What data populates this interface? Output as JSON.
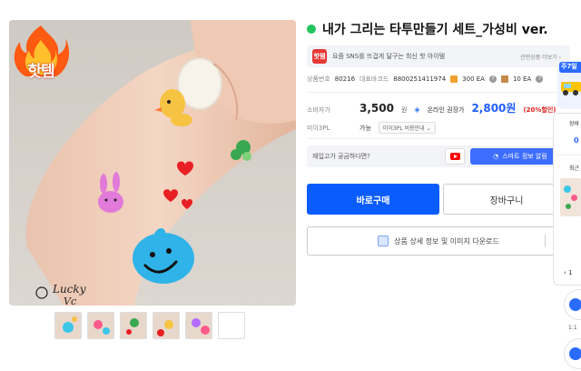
{
  "product": {
    "hot_badge": "핫템",
    "title": "내가 그리는 타투만들기 세트_가성비 ver.",
    "banner_icon": "핫템",
    "banner_text": "요즘 SNS를 뜨겁게 달구는 최신 핫 아이템",
    "banner_link": "관련상품 더보기 ›",
    "code_label": "상품번호",
    "code_value": "80216",
    "barcode_label": "대표바코드",
    "barcode_value": "8800251411974",
    "box_qty": "300 EA",
    "inner_qty": "10 EA",
    "consumer_label": "소비자가",
    "consumer_price": "3,500",
    "won": "원",
    "online_label": "온라인 권장가",
    "online_price": "2,800원",
    "discount": "(20%할인)",
    "pl_label": "미이3PL",
    "pl_sub": "가능",
    "pl_select": "미이3PL 비용안내 ⌄",
    "stock_question": "재입고가 궁금하다면?",
    "smart_alert": "스마트 정보 알림",
    "buy_now": "바로구매",
    "cart": "장바구니",
    "detail_download": "상품 상세 정보 및 이미지 다운로드"
  },
  "thumbnails": [
    {
      "accent": "#3cc6e8"
    },
    {
      "accent": "#ff5a8a"
    },
    {
      "accent": "#3aa850"
    },
    {
      "accent": "#f6c343"
    },
    {
      "accent": "#b36bff"
    },
    {
      "accent": ""
    }
  ],
  "side_widget": {
    "tag": "주7일",
    "panel_title_1": "장바",
    "panel_count": "0",
    "panel_title_2": "최근",
    "nav": "‹ 1",
    "small_text": "1:1"
  },
  "colors": {
    "primary": "#0a5cff",
    "accent_blue": "#2b6bff",
    "discount_red": "#e02020",
    "green_dot": "#22c55e"
  },
  "icons": [
    "fire-badge-icon",
    "green-dot-icon",
    "hot-item-icon",
    "box-icon",
    "question-icon",
    "inner-box-icon",
    "online-price-icon",
    "youtube-icon",
    "bell-icon",
    "image-download-icon",
    "delivery-truck-icon"
  ]
}
